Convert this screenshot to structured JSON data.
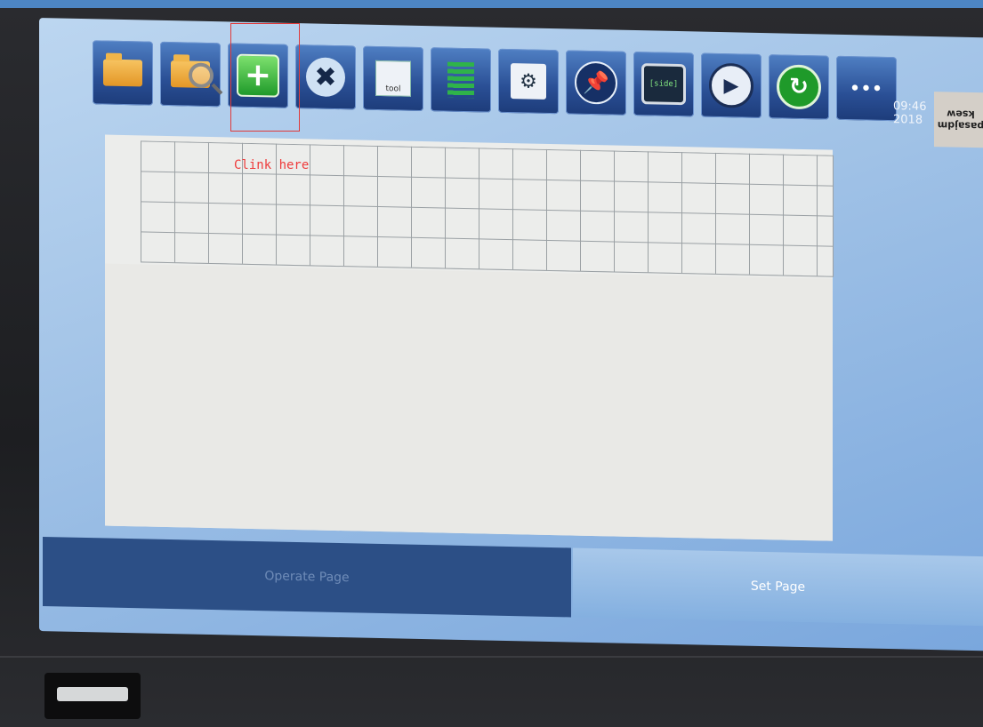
{
  "annotation": {
    "text": "Clink here"
  },
  "toolbar": {
    "items": [
      {
        "name": "open-folder",
        "label": "",
        "icon": "folder-icon"
      },
      {
        "name": "search-folder",
        "label": "",
        "icon": "folder-search-icon"
      },
      {
        "name": "add",
        "label": "",
        "icon": "plus-icon"
      },
      {
        "name": "delete",
        "label": "",
        "icon": "close-icon"
      },
      {
        "name": "tool",
        "label": "tool",
        "icon": "tool-document-icon"
      },
      {
        "name": "list",
        "label": "",
        "icon": "list-lines-icon"
      },
      {
        "name": "settings",
        "label": "",
        "icon": "gear-icon"
      },
      {
        "name": "pin",
        "label": "",
        "icon": "pin-icon"
      },
      {
        "name": "code",
        "label": "[side]",
        "icon": "code-screen-icon"
      },
      {
        "name": "play",
        "label": "",
        "icon": "play-icon"
      },
      {
        "name": "refresh",
        "label": "",
        "icon": "refresh-icon"
      },
      {
        "name": "more",
        "label": "•••",
        "icon": "more-icon"
      }
    ]
  },
  "status": {
    "time": "09:46",
    "date": "2018"
  },
  "sticker": {
    "line1": "pasajdm",
    "line2": "ksew"
  },
  "tabs": {
    "operate": "Operate Page",
    "set": "Set Page"
  },
  "colors": {
    "accent": "#4d86c4",
    "annotation": "#ee3b3b",
    "active_tab": "#2c4f86"
  }
}
